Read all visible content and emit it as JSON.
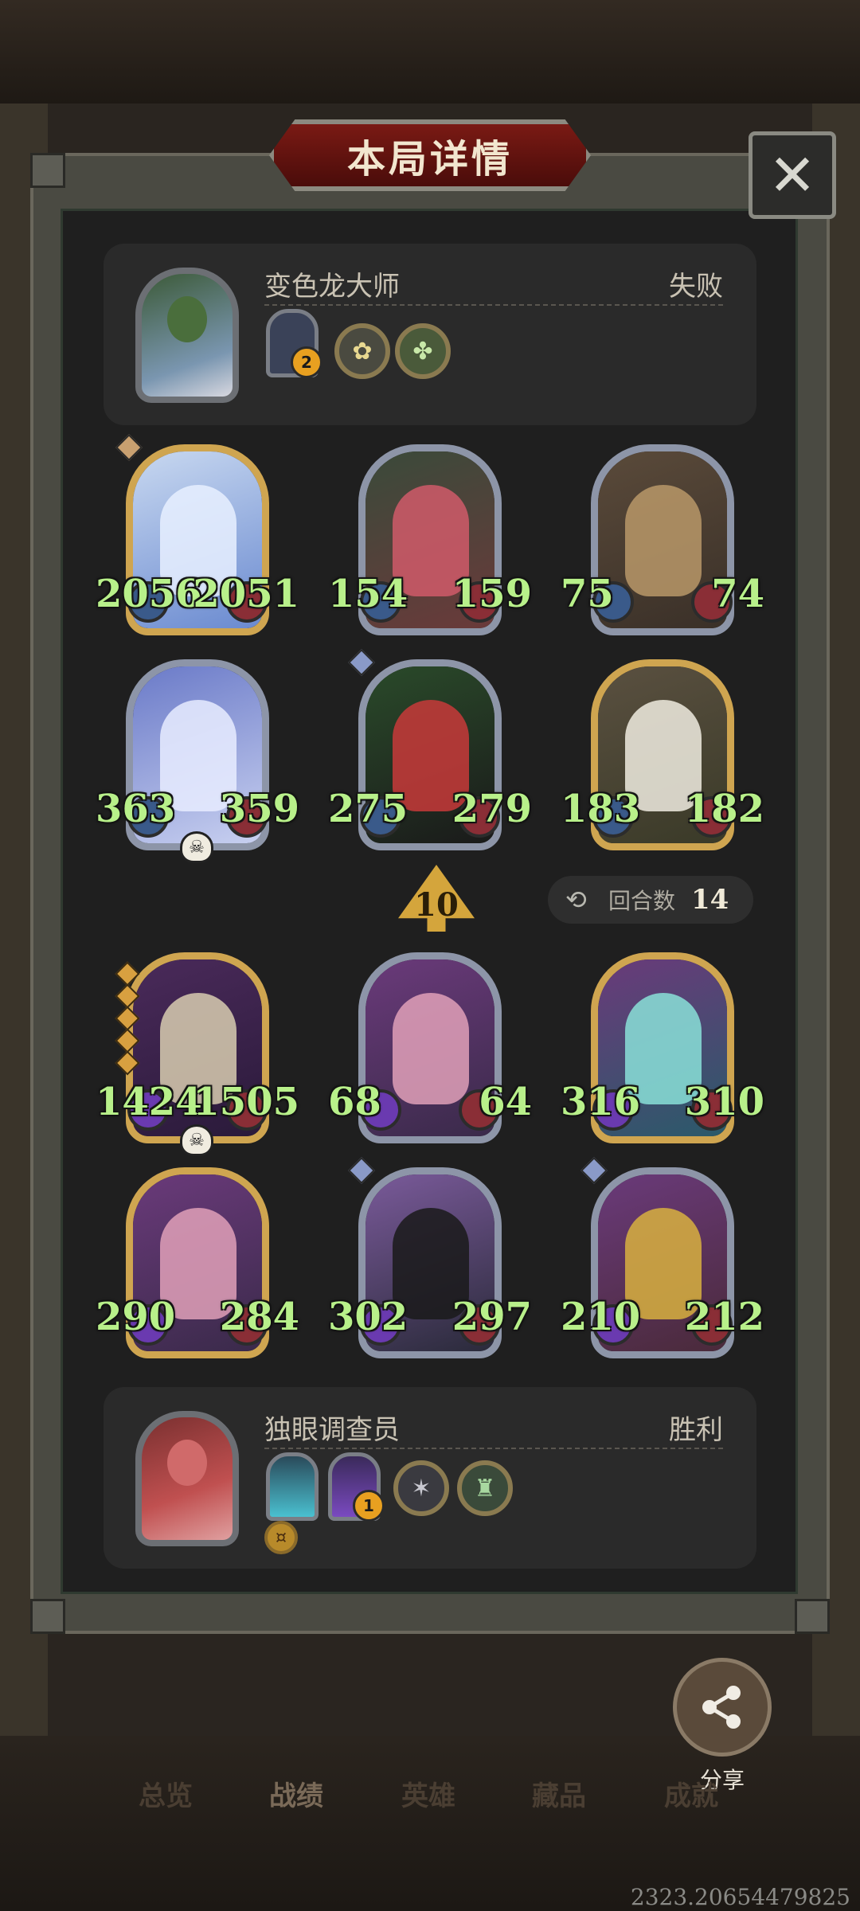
{
  "header": {
    "title": "本局详情",
    "close_icon": "✕"
  },
  "top_player": {
    "name": "变色龙大师",
    "result": "失败",
    "items": [
      {
        "icon": "tombstone-shield-icon",
        "badge": "2"
      },
      {
        "icon": "flower-coin-icon"
      },
      {
        "icon": "clover-coin-icon"
      }
    ]
  },
  "top_board": [
    {
      "attack": "2056",
      "health": "2051",
      "frame": "gold"
    },
    {
      "attack": "154",
      "health": "159",
      "frame": "silver"
    },
    {
      "attack": "75",
      "health": "74",
      "frame": "silver"
    },
    {
      "attack": "363",
      "health": "359",
      "frame": "silver"
    },
    {
      "attack": "275",
      "health": "279",
      "frame": "silver"
    },
    {
      "attack": "183",
      "health": "182",
      "frame": "gold"
    }
  ],
  "turn": {
    "damage": "10",
    "round_label": "回合数",
    "round_value": "14"
  },
  "bottom_board": [
    {
      "attack": "1424",
      "health": "1505",
      "frame": "gold"
    },
    {
      "attack": "68",
      "health": "64",
      "frame": "silver"
    },
    {
      "attack": "316",
      "health": "310",
      "frame": "gold"
    },
    {
      "attack": "290",
      "health": "284",
      "frame": "gold"
    },
    {
      "attack": "302",
      "health": "297",
      "frame": "silver"
    },
    {
      "attack": "210",
      "health": "212",
      "frame": "silver"
    }
  ],
  "bottom_player": {
    "name": "独眼调查员",
    "result": "胜利",
    "items": [
      {
        "icon": "crystal-shield-icon"
      },
      {
        "icon": "mask-shield-icon",
        "badge": "1"
      },
      {
        "icon": "bug-coin-icon"
      },
      {
        "icon": "totem-coin-icon"
      },
      {
        "icon": "gold-coin-icon"
      }
    ]
  },
  "share": {
    "label": "分享"
  },
  "tabs": [
    "总览",
    "战绩",
    "英雄",
    "藏品",
    "成就"
  ],
  "version": "2323.20654479825",
  "colors": {
    "stat_text": "#b8f08a",
    "gold_frame": "#cfa550",
    "silver_frame": "#8d95a8",
    "title_plate": "#7a1a14"
  }
}
